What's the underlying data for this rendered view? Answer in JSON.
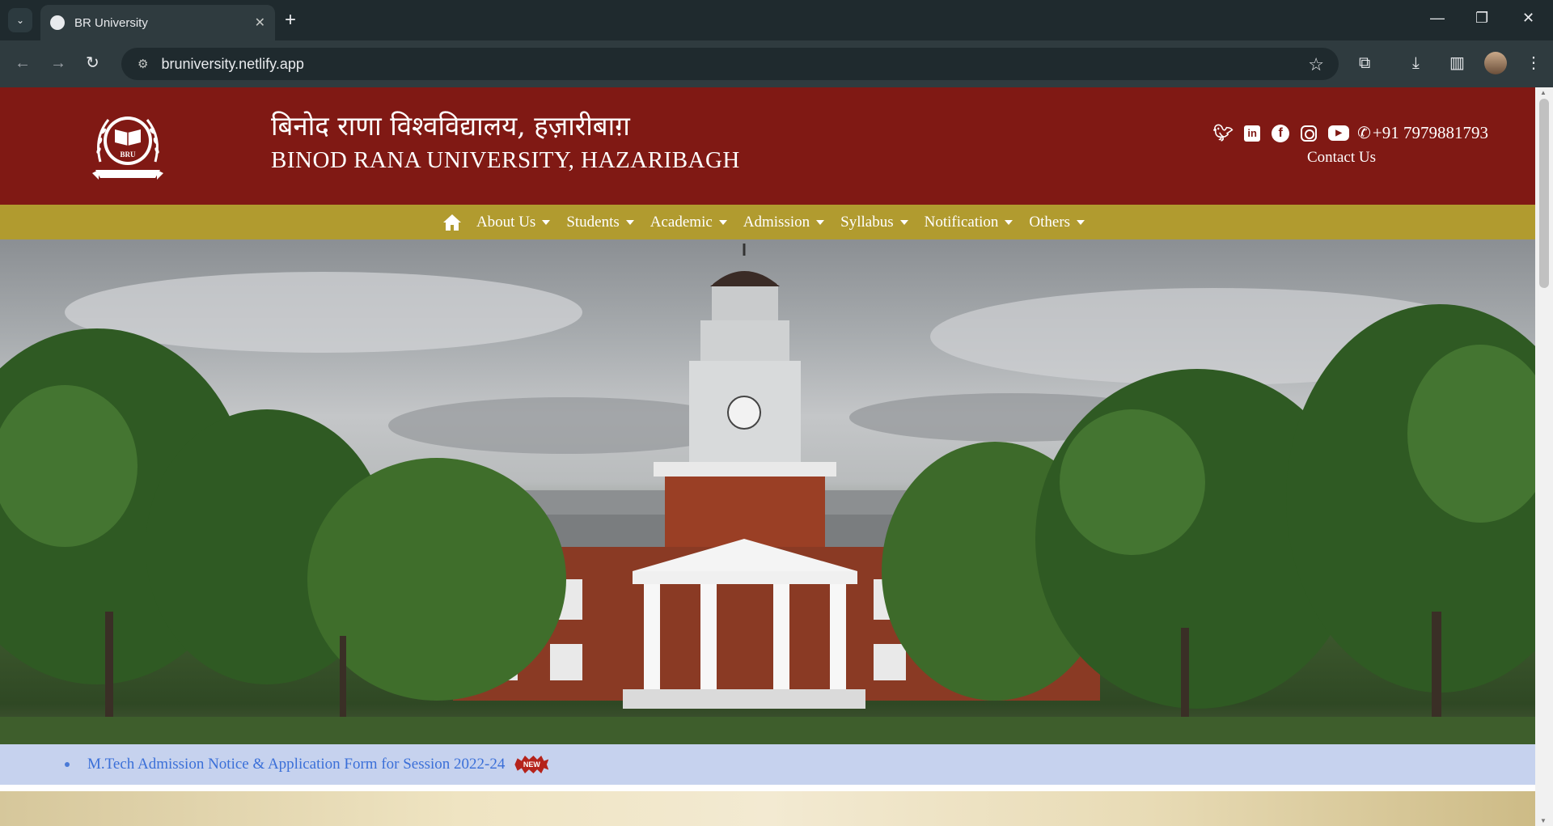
{
  "browser": {
    "tab_title": "BR University",
    "tab_close": "✕",
    "new_tab": "+",
    "url": "bruniversity.netlify.app",
    "window": {
      "minimize": "—",
      "restore": "❐",
      "close": "✕"
    }
  },
  "header": {
    "logo_text": "BRU",
    "title_hindi": "बिनोद राणा विश्वविद्यालय, हज़ारीबाग़",
    "title_english": "BINOD RANA UNIVERSITY, HAZARIBAGH",
    "social": [
      "twitter-icon",
      "linkedin-icon",
      "facebook-icon",
      "instagram-icon",
      "youtube-icon"
    ],
    "phone": "+91 7979881793",
    "contact_label": "Contact Us"
  },
  "nav": {
    "items": [
      "About Us",
      "Students",
      "Academic",
      "Admission",
      "Syllabus",
      "Notification",
      "Others"
    ]
  },
  "ticker": {
    "items": [
      {
        "text": "M.Tech Admission Notice & Application Form for Session 2022-24",
        "badge": "NEW"
      }
    ]
  },
  "colors": {
    "header_bg": "#801914",
    "nav_bg": "#b19b2f",
    "ticker_bg": "#c6d2ee",
    "ticker_link": "#3a6fd8",
    "badge_bg": "#b5231b"
  }
}
